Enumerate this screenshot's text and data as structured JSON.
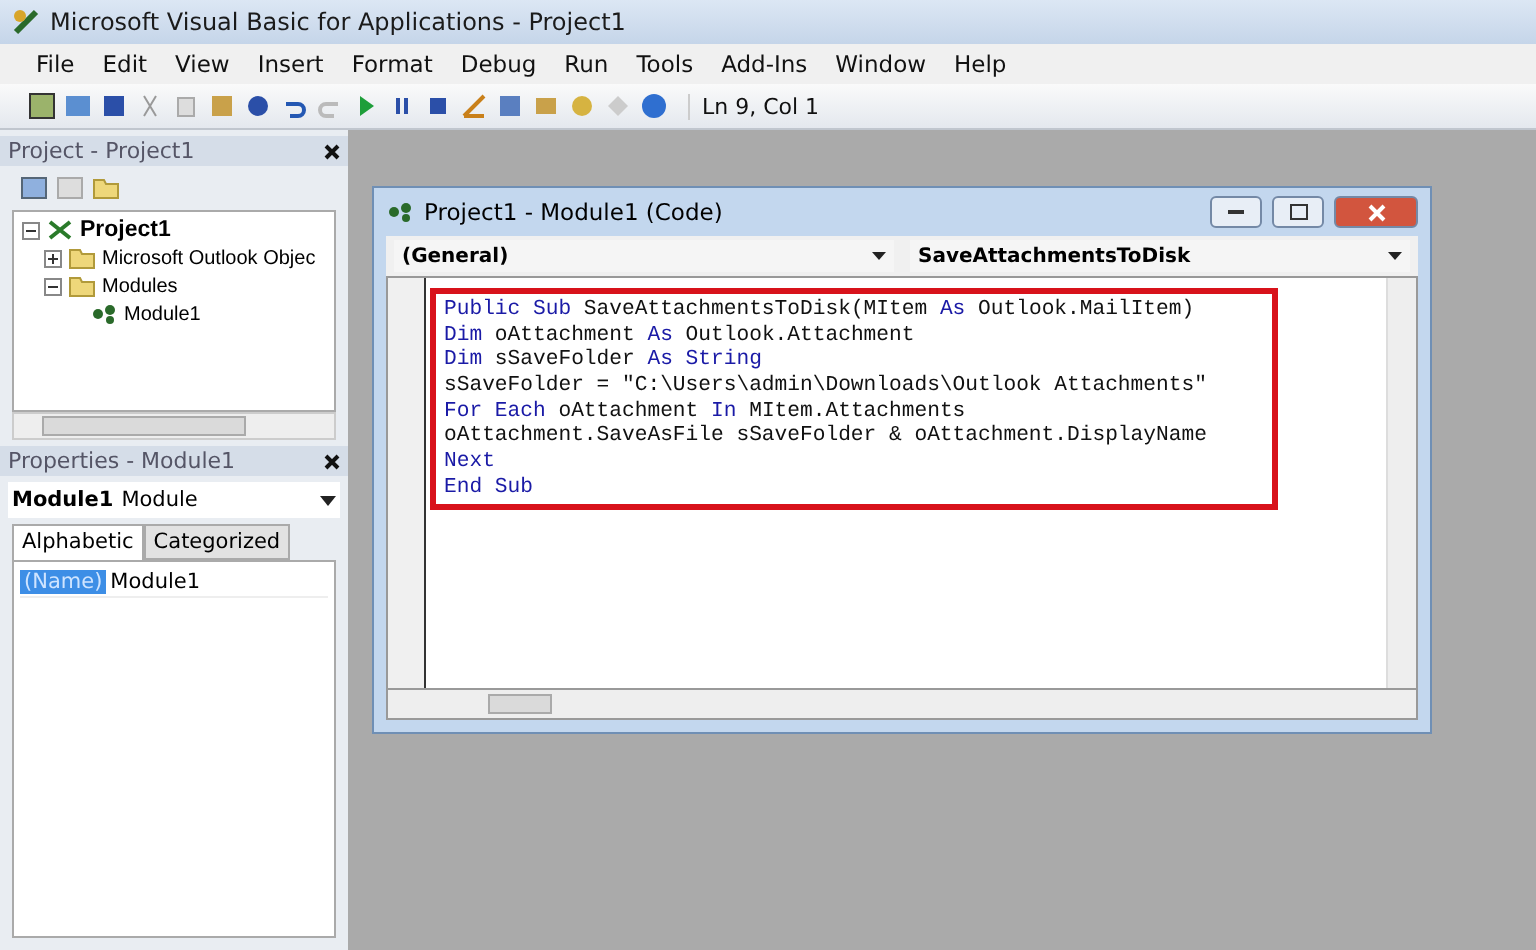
{
  "window": {
    "title": "Microsoft Visual Basic for Applications - Project1"
  },
  "menu": [
    "File",
    "Edit",
    "View",
    "Insert",
    "Format",
    "Debug",
    "Run",
    "Tools",
    "Add-Ins",
    "Window",
    "Help"
  ],
  "toolbar": {
    "position": "Ln 9, Col 1"
  },
  "project_pane": {
    "title": "Project - Project1",
    "tree": [
      {
        "label": "Project1",
        "kind": "project",
        "expanded": true,
        "children": [
          {
            "label": "Microsoft Outlook Objec",
            "kind": "folder",
            "expanded": false
          },
          {
            "label": "Modules",
            "kind": "folder",
            "expanded": true,
            "children": [
              {
                "label": "Module1",
                "kind": "module"
              }
            ]
          }
        ]
      }
    ]
  },
  "properties_pane": {
    "title": "Properties - Module1",
    "object_name": "Module1",
    "object_type": "Module",
    "tabs": [
      {
        "label": "Alphabetic",
        "selected": true
      },
      {
        "label": "Categorized",
        "selected": false
      }
    ],
    "rows": [
      {
        "name": "(Name)",
        "value": "Module1",
        "selected": true
      }
    ]
  },
  "code_window": {
    "title": "Project1 - Module1 (Code)",
    "object_dropdown": "(General)",
    "procedure_dropdown": "SaveAttachmentsToDisk",
    "lines": [
      [
        {
          "text": "Public Sub",
          "kind": "keyword"
        },
        {
          "text": " SaveAttachmentsToDisk(MItem ",
          "kind": "plain"
        },
        {
          "text": "As",
          "kind": "keyword"
        },
        {
          "text": " Outlook.MailItem)",
          "kind": "plain"
        }
      ],
      [
        {
          "text": "Dim",
          "kind": "keyword"
        },
        {
          "text": " oAttachment ",
          "kind": "plain"
        },
        {
          "text": "As",
          "kind": "keyword"
        },
        {
          "text": " Outlook.Attachment",
          "kind": "plain"
        }
      ],
      [
        {
          "text": "Dim",
          "kind": "keyword"
        },
        {
          "text": " sSaveFolder ",
          "kind": "plain"
        },
        {
          "text": "As String",
          "kind": "keyword"
        }
      ],
      [
        {
          "text": "sSaveFolder = \"C:\\Users\\admin\\Downloads\\Outlook Attachments\"",
          "kind": "plain"
        }
      ],
      [
        {
          "text": "For Each",
          "kind": "keyword"
        },
        {
          "text": " oAttachment ",
          "kind": "plain"
        },
        {
          "text": "In",
          "kind": "keyword"
        },
        {
          "text": " MItem.Attachments",
          "kind": "plain"
        }
      ],
      [
        {
          "text": "oAttachment.SaveAsFile sSaveFolder & oAttachment.DisplayName",
          "kind": "plain"
        }
      ],
      [
        {
          "text": "Next",
          "kind": "keyword"
        }
      ],
      [
        {
          "text": "End Sub",
          "kind": "keyword"
        }
      ]
    ]
  }
}
